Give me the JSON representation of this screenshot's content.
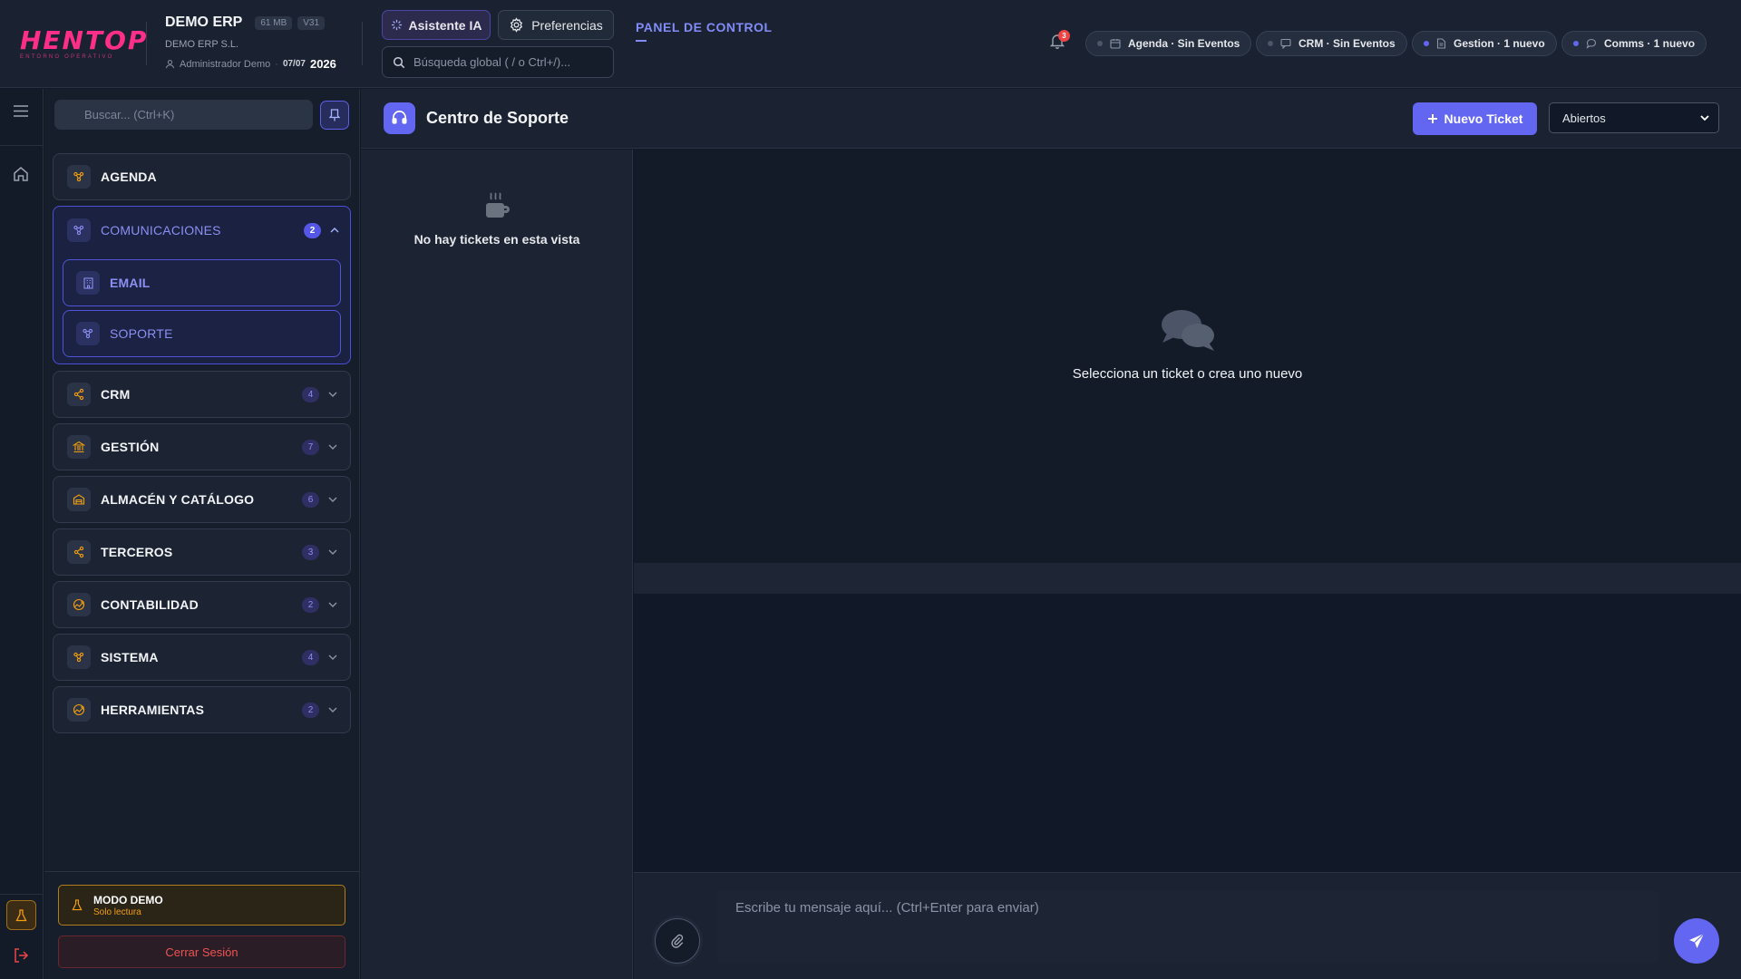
{
  "header": {
    "brand": {
      "logo": "HENTOP",
      "logo_subtitle": "ENTORNO OPERATIVO",
      "title": "DEMO ERP",
      "memory": "61 MB",
      "version": "V31",
      "company": "DEMO ERP S.L.",
      "user": "Administrador Demo",
      "date": "07/07",
      "year": "2026"
    },
    "ai_button": "Asistente IA",
    "prefs_button": "Preferencias",
    "global_search_placeholder": "Búsqueda global ( / o Ctrl+/)...",
    "panel_title": "PANEL DE CONTROL",
    "notifications_count": "3",
    "chips": [
      {
        "label": "Agenda · Sin Eventos",
        "active": false
      },
      {
        "label": "CRM · Sin Eventos",
        "active": false
      },
      {
        "label": "Gestion · 1 nuevo",
        "active": true
      },
      {
        "label": "Comms · 1 nuevo",
        "active": true
      }
    ]
  },
  "sidebar": {
    "search_placeholder": "Buscar... (Ctrl+K)",
    "items": {
      "agenda": {
        "label": "AGENDA"
      },
      "comunicaciones": {
        "label": "COMUNICACIONES",
        "count": "2",
        "children": {
          "email": "EMAIL",
          "soporte": "SOPORTE"
        }
      },
      "crm": {
        "label": "CRM",
        "count": "4"
      },
      "gestion": {
        "label": "GESTIÓN",
        "count": "7"
      },
      "almacen": {
        "label": "ALMACÉN Y CATÁLOGO",
        "count": "6"
      },
      "terceros": {
        "label": "TERCEROS",
        "count": "3"
      },
      "contabilidad": {
        "label": "CONTABILIDAD",
        "count": "2"
      },
      "sistema": {
        "label": "SISTEMA",
        "count": "4"
      },
      "herramientas": {
        "label": "HERRAMIENTAS",
        "count": "2"
      }
    },
    "demo": {
      "title": "MODO DEMO",
      "subtitle": "Solo lectura"
    },
    "logout": "Cerrar Sesión"
  },
  "main": {
    "title": "Centro de Soporte",
    "new_ticket": "Nuevo Ticket",
    "filter_value": "Abiertos",
    "empty_list": "No hay tickets en esta vista",
    "empty_detail": "Selecciona un ticket o crea uno nuevo",
    "composer_placeholder": "Escribe tu mensaje aquí... (Ctrl+Enter para enviar)"
  },
  "colors": {
    "accent": "#6366f1",
    "brand": "#ff2e88",
    "warning": "#f59e0b",
    "danger": "#ef4444"
  }
}
